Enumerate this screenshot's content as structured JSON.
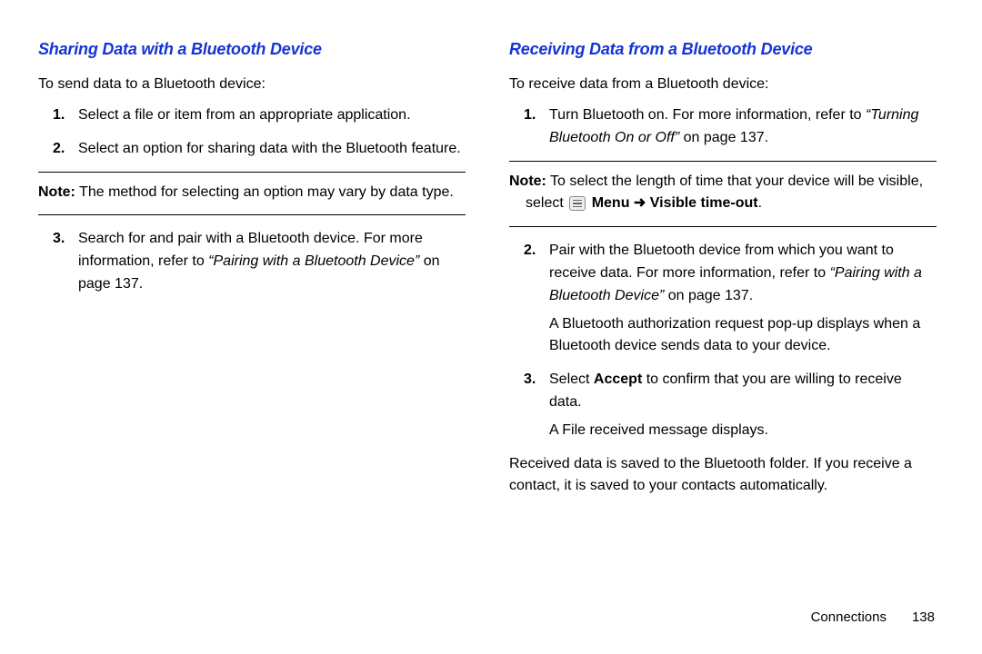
{
  "left": {
    "heading": "Sharing Data with a Bluetooth Device",
    "intro": "To send data to a Bluetooth device:",
    "step1": "Select a file or item from an appropriate application.",
    "step2": "Select an option for sharing data with the Bluetooth feature.",
    "note_label": "Note:",
    "note_text": " The method for selecting an option may vary by data type.",
    "step3a": "Search for and pair with a Bluetooth device. For more information, refer to ",
    "step3_xref": "“Pairing with a Bluetooth Device”",
    "step3b": " on page 137."
  },
  "right": {
    "heading": "Receiving Data from a Bluetooth Device",
    "intro": "To receive data from a Bluetooth device:",
    "step1a": "Turn Bluetooth on. For more information, refer to ",
    "step1_xref": "“Turning Bluetooth On or Off”",
    "step1b": " on page 137.",
    "note_label": "Note:",
    "note_text1": " To select the length of time that your device will be visible, select ",
    "note_menu": "Menu",
    "note_arrow": " ➜ ",
    "note_visible": "Visible time-out",
    "note_text2": ".",
    "step2a": "Pair with the Bluetooth device from which you want to receive data. For more information, refer to ",
    "step2_xref": "“Pairing with a Bluetooth Device”",
    "step2b": " on page 137.",
    "step2_sub": "A Bluetooth authorization request pop-up displays when a Bluetooth device sends data to your device.",
    "step3a": "Select ",
    "step3_bold": "Accept",
    "step3b": " to confirm that you are willing to receive data.",
    "step3_sub": "A File received message displays.",
    "outro": "Received data is saved to the Bluetooth folder. If you receive a contact, it is saved to your contacts automatically."
  },
  "footer": {
    "section": "Connections",
    "page": "138"
  }
}
